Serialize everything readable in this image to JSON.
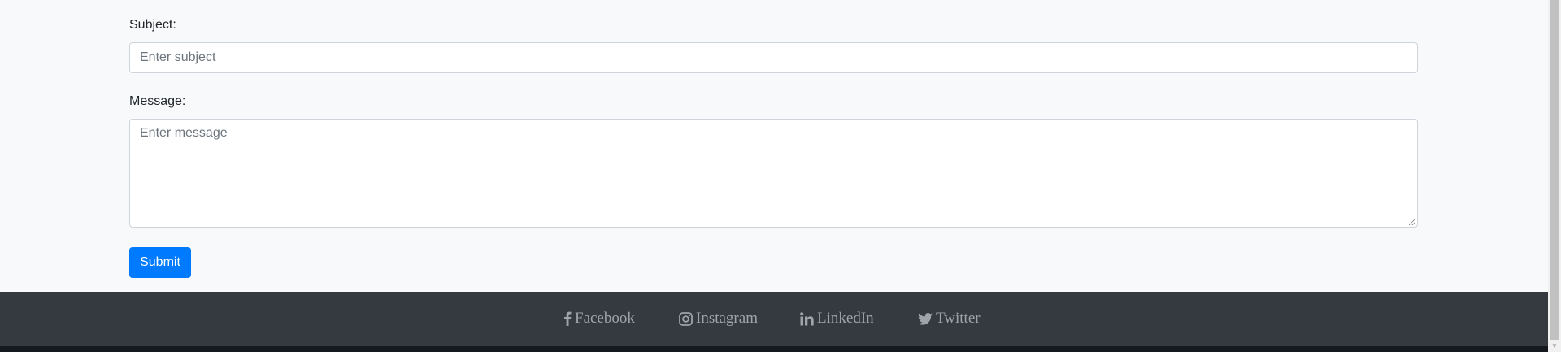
{
  "form": {
    "subject_label": "Subject:",
    "subject_placeholder": "Enter subject",
    "message_label": "Message:",
    "message_placeholder": "Enter message",
    "submit_label": "Submit"
  },
  "footer": {
    "links": [
      {
        "label": "Facebook",
        "icon": "facebook-icon"
      },
      {
        "label": "Instagram",
        "icon": "instagram-icon"
      },
      {
        "label": "LinkedIn",
        "icon": "linkedin-icon"
      },
      {
        "label": "Twitter",
        "icon": "twitter-icon"
      }
    ]
  },
  "colors": {
    "primary": "#007bff",
    "footer_bg": "#343a40",
    "page_bg": "#f8f9fa"
  }
}
